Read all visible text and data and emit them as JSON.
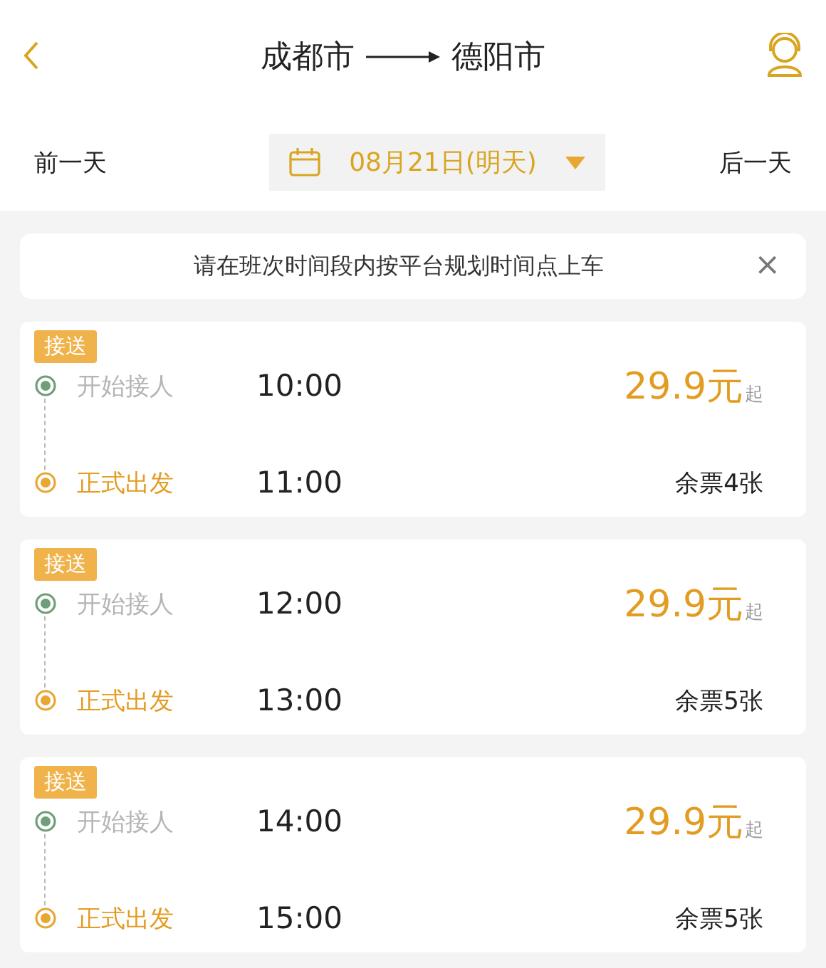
{
  "header": {
    "from": "成都市",
    "to": "德阳市"
  },
  "date_bar": {
    "prev": "前一天",
    "date": "08月21日(明天)",
    "next": "后一天"
  },
  "notice": {
    "text": "请在班次时间段内按平台规划时间点上车",
    "close": "×"
  },
  "trips": [
    {
      "tag": "接送",
      "price": "29.9元",
      "price_suffix": "起",
      "seats": "余票4张",
      "stops": [
        {
          "kind": "pickup",
          "label": "开始接人",
          "time": "10:00"
        },
        {
          "kind": "depart",
          "label": "正式出发",
          "time": "11:00"
        }
      ]
    },
    {
      "tag": "接送",
      "price": "29.9元",
      "price_suffix": "起",
      "seats": "余票5张",
      "stops": [
        {
          "kind": "pickup",
          "label": "开始接人",
          "time": "12:00"
        },
        {
          "kind": "depart",
          "label": "正式出发",
          "time": "13:00"
        }
      ]
    },
    {
      "tag": "接送",
      "price": "29.9元",
      "price_suffix": "起",
      "seats": "余票5张",
      "stops": [
        {
          "kind": "pickup",
          "label": "开始接人",
          "time": "14:00"
        },
        {
          "kind": "depart",
          "label": "正式出发",
          "time": "15:00"
        }
      ]
    }
  ]
}
